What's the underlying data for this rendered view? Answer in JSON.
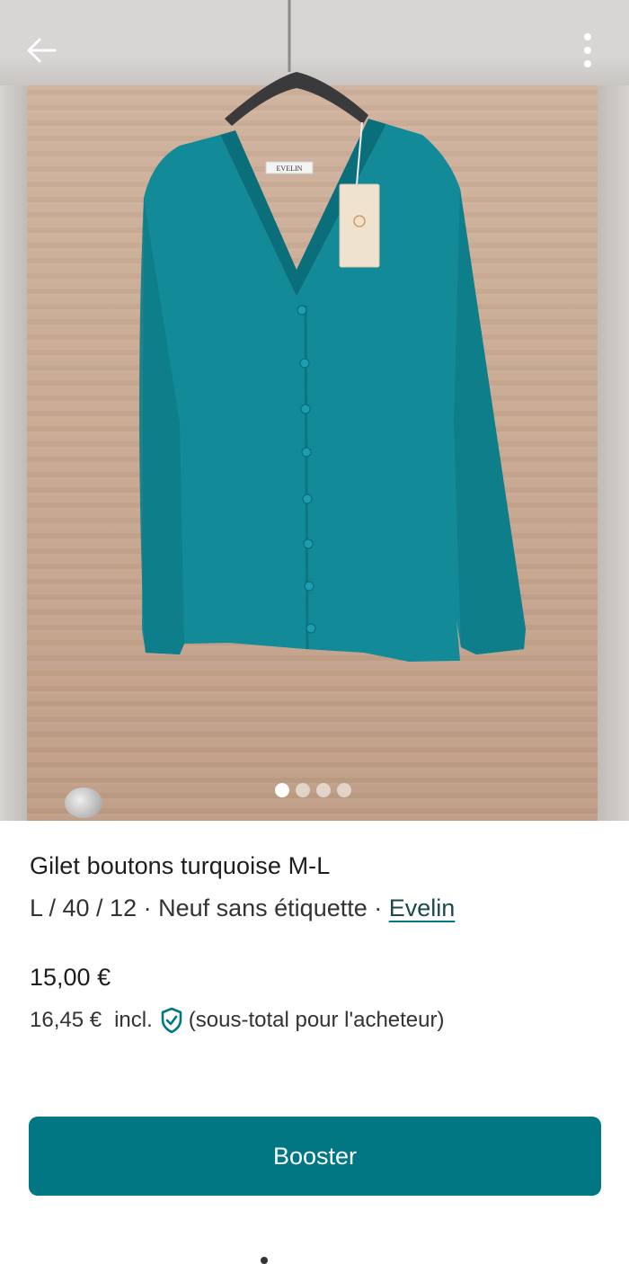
{
  "header": {
    "back_icon": "arrow-left-icon",
    "menu_icon": "more-vertical-icon"
  },
  "gallery": {
    "image_count": 4,
    "active_index": 0,
    "garment_label": "EVELIN"
  },
  "item": {
    "title": "Gilet boutons turquoise M-L",
    "size": "L / 40 / 12",
    "separator": " · ",
    "condition": "Neuf sans étiquette",
    "brand": "Evelin"
  },
  "pricing": {
    "price": "15,00 €",
    "price_incl": "16,45 €",
    "incl_label": "incl.",
    "shield_icon": "shield-check-icon",
    "buyer_note": "(sous-total pour l'acheteur)"
  },
  "actions": {
    "booster_label": "Booster"
  },
  "colors": {
    "accent": "#007782",
    "garment": "#128a98"
  }
}
